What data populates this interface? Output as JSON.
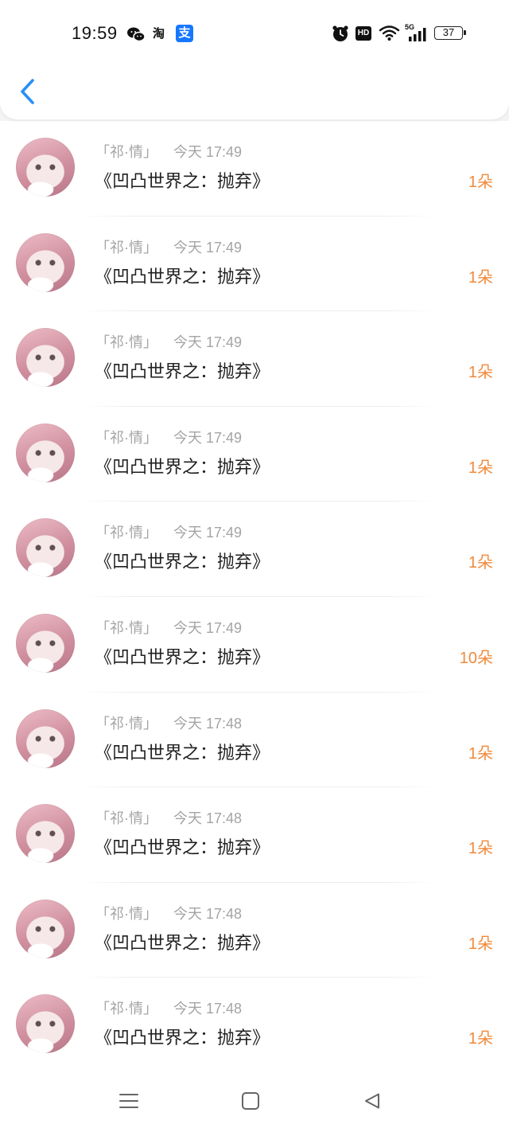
{
  "status_bar": {
    "time": "19:59",
    "app_icons": [
      "wechat-icon",
      "taobao-icon",
      "alipay-icon"
    ],
    "taobao_label": "淘",
    "alipay_label": "支",
    "system_icons": [
      "alarm-icon",
      "hd-icon",
      "wifi-icon",
      "signal-icon",
      "battery-icon"
    ],
    "hd_label": "HD",
    "network_label": "5G",
    "battery_level": "37"
  },
  "header": {
    "back_icon": "chevron-left-icon"
  },
  "records": [
    {
      "name": "「祁·情」",
      "time": "今天 17:49",
      "title": "《凹凸世界之：抛弃》",
      "amount": "1朵"
    },
    {
      "name": "「祁·情」",
      "time": "今天 17:49",
      "title": "《凹凸世界之：抛弃》",
      "amount": "1朵"
    },
    {
      "name": "「祁·情」",
      "time": "今天 17:49",
      "title": "《凹凸世界之：抛弃》",
      "amount": "1朵"
    },
    {
      "name": "「祁·情」",
      "time": "今天 17:49",
      "title": "《凹凸世界之：抛弃》",
      "amount": "1朵"
    },
    {
      "name": "「祁·情」",
      "time": "今天 17:49",
      "title": "《凹凸世界之：抛弃》",
      "amount": "1朵"
    },
    {
      "name": "「祁·情」",
      "time": "今天 17:49",
      "title": "《凹凸世界之：抛弃》",
      "amount": "10朵"
    },
    {
      "name": "「祁·情」",
      "time": "今天 17:48",
      "title": "《凹凸世界之：抛弃》",
      "amount": "1朵"
    },
    {
      "name": "「祁·情」",
      "time": "今天 17:48",
      "title": "《凹凸世界之：抛弃》",
      "amount": "1朵"
    },
    {
      "name": "「祁·情」",
      "time": "今天 17:48",
      "title": "《凹凸世界之：抛弃》",
      "amount": "1朵"
    },
    {
      "name": "「祁·情」",
      "time": "今天 17:48",
      "title": "《凹凸世界之：抛弃》",
      "amount": "1朵"
    }
  ],
  "nav_bar": {
    "icons": [
      "menu-icon",
      "home-square-icon",
      "back-triangle-icon"
    ]
  },
  "colors": {
    "accent": "#2a8ff7",
    "amount": "#f08a3c",
    "meta_text": "#a4a4a4",
    "title_text": "#1f1f1f",
    "alipay_brand": "#1677ff"
  }
}
